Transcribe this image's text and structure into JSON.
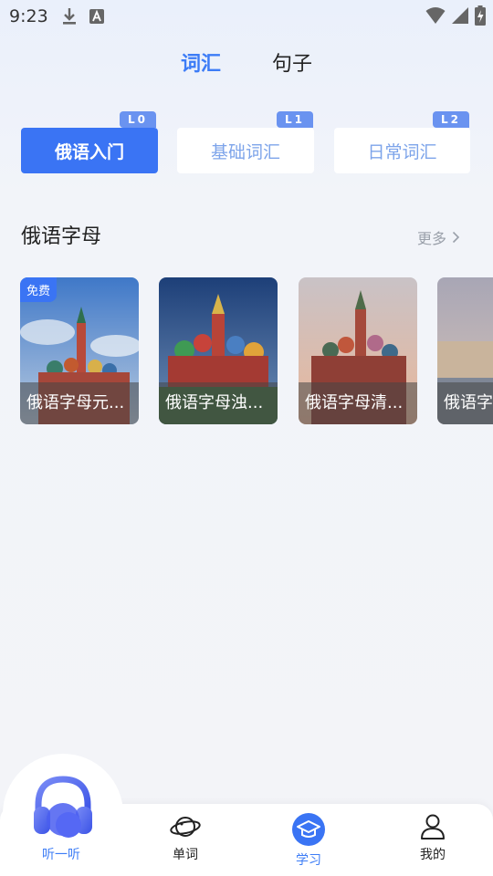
{
  "status": {
    "time": "9:23"
  },
  "top_tabs": [
    {
      "label": "词汇",
      "active": true
    },
    {
      "label": "句子",
      "active": false
    }
  ],
  "levels": [
    {
      "label": "俄语入门",
      "badge": "L0"
    },
    {
      "label": "基础词汇",
      "badge": "L1"
    },
    {
      "label": "日常词汇",
      "badge": "L2"
    }
  ],
  "section": {
    "title": "俄语字母",
    "more": "更多"
  },
  "courses": [
    {
      "title": "俄语字母元...",
      "badge": "免费"
    },
    {
      "title": "俄语字母浊..."
    },
    {
      "title": "俄语字母清..."
    },
    {
      "title": "俄语字"
    }
  ],
  "tab_bar": {
    "listen": "听一听",
    "words": "单词",
    "study": "学习",
    "mine": "我的"
  },
  "colors": {
    "accent": "#3a74f4",
    "accent_text": "#3c7cf6"
  }
}
